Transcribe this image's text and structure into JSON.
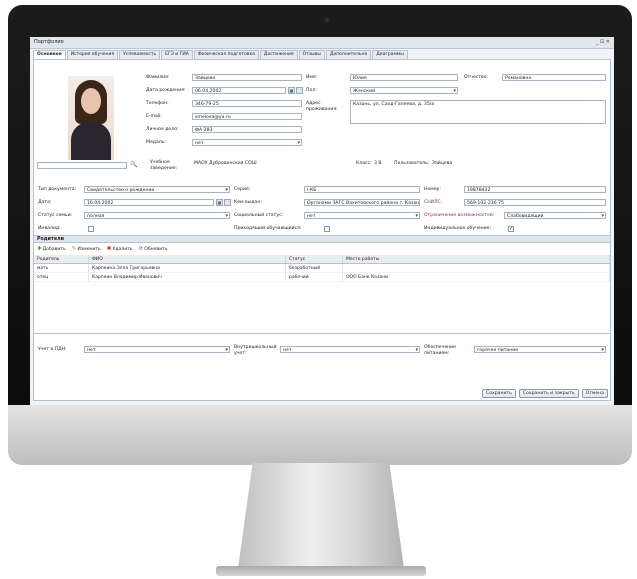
{
  "window": {
    "title": "Портфолио",
    "controls": "_ ⊡ ✕"
  },
  "tabs": [
    "Основное",
    "История обучения",
    "Успеваемость",
    "ЕГЭ и ГИА",
    "Физическая подготовка",
    "Достижения",
    "Отзывы",
    "Дополнительно",
    "Диаграммы"
  ],
  "personal": {
    "surname_label": "Фамилия:",
    "surname": "Зайцева",
    "name_label": "Имя:",
    "name": "Юлия",
    "patronymic_label": "Отчество:",
    "patronymic": "Романовна",
    "birth_label": "Дата рождения:",
    "birth": "06.04.2002",
    "gender_label": "Пол:",
    "gender": "Женский",
    "phone_label": "Телефон:",
    "phone": "346-79-25",
    "address_label": "Адрес проживания:",
    "address": "Казань, ул. Сахд-Гапеева, д. 35/а",
    "email_label": "E-mail:",
    "email": "smelova@ya.ru",
    "file_label": "Личное дело:",
    "file": "ФА-283",
    "medal_label": "Медаль:",
    "medal": "нет",
    "school_label": "Учебное заведение:",
    "school": "МАОУ Дубровинская СОШ",
    "class_label": "Класс:",
    "class": "3 В",
    "user_label": "Пользователь:",
    "user": "Зайцева"
  },
  "document": {
    "type_label": "Тип документа:",
    "type": "Свидетельство о рождении",
    "series_label": "Серия:",
    "series": "I-КБ",
    "number_label": "Номер:",
    "number": "19878432",
    "date_label": "Дата:",
    "date": "16.04.2002",
    "issued_label": "Кем выдан:",
    "issued": "Органами ЗАГС Вахитовского района г. Казани",
    "snils_label": "СНИЛС:",
    "snils": "569-102-236 75",
    "family_label": "Статус семьи:",
    "family": "полная",
    "social_label": "Социальный статус:",
    "social": "нет",
    "limits_label": "Ограничение возможностей:",
    "limits": "Слабовидящий",
    "invalid_label": "Инвалид:",
    "transfer_label": "Приходящий обучающийся:",
    "individual_label": "Индивидуальное обучение:",
    "individual_check": "✓"
  },
  "parents": {
    "header": "Родители",
    "toolbar": {
      "add": "Добавить",
      "edit": "Изменить",
      "delete": "Удалить",
      "refresh": "Обновить"
    },
    "columns": [
      "Родитель",
      "ФИО",
      "Статус",
      "Место работы"
    ],
    "rows": [
      [
        "мать",
        "Карпкина Элла Григорьевна",
        "безработный",
        ""
      ],
      [
        "отец",
        "Карпкин Владимир Иванович",
        "рабочий",
        "ООО Банк Казани"
      ]
    ]
  },
  "footer_fields": {
    "pdn_label": "Учет в ПДН:",
    "pdn": "нет",
    "internal_label": "Внутришкольный учет:",
    "internal": "нет",
    "meals_label": "Обеспечение питанием:",
    "meals": "горячее питание"
  },
  "buttons": {
    "save": "Сохранить",
    "save_close": "Сохранить и закрыть",
    "cancel": "Отмена"
  },
  "icons": {
    "search": "🔍",
    "calendar": "▦",
    "add": "✚",
    "edit": "✎",
    "delete": "✖",
    "refresh": "⟳"
  }
}
